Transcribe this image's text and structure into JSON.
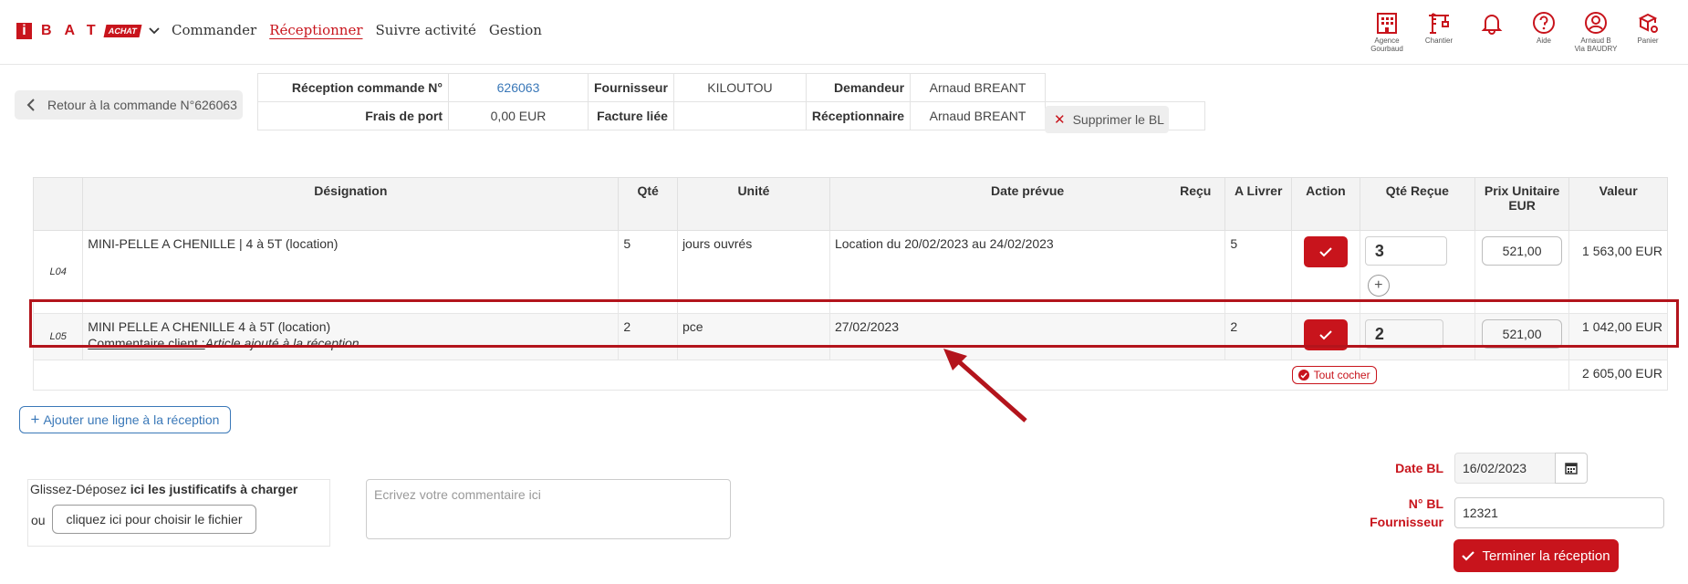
{
  "header": {
    "logo_i": "i",
    "logo_letters": "BAT",
    "logo_tag": "ACHAT",
    "nav": [
      "Commander",
      "Réceptionner",
      "Suivre activité",
      "Gestion"
    ],
    "icons": [
      {
        "name": "agency-icon",
        "label": "Agence\nGourbaud"
      },
      {
        "name": "crane-icon",
        "label": "Chantier"
      },
      {
        "name": "bell-icon",
        "label": ""
      },
      {
        "name": "help-icon",
        "label": "Aide"
      },
      {
        "name": "user-icon",
        "label": "Arnaud B\nVia BAUDRY"
      },
      {
        "name": "cart-icon",
        "label": "Panier"
      }
    ]
  },
  "info": {
    "back_label": "Retour à la commande N°626063",
    "reception_label": "Réception commande N°",
    "reception_value": "626063",
    "supplier_label": "Fournisseur",
    "supplier_value": "KILOUTOU",
    "requester_label": "Demandeur",
    "requester_value": "Arnaud BREANT",
    "shipping_label": "Frais de port",
    "shipping_value": "0,00 EUR",
    "invoice_label": "Facture liée",
    "invoice_value": "",
    "receiver_label": "Réceptionnaire",
    "receiver_value": "Arnaud BREANT",
    "delete_bl_label": "Supprimer le BL"
  },
  "table": {
    "headers": {
      "designation": "Désignation",
      "qty": "Qté",
      "unit": "Unité",
      "date": "Date prévue",
      "recu": "Reçu",
      "a_livrer": "A Livrer",
      "action": "Action",
      "qty_recue": "Qté Reçue",
      "prix": "Prix Unitaire EUR",
      "valeur": "Valeur"
    },
    "rows": [
      {
        "code": "L04",
        "designation": "MINI-PELLE A CHENILLE | 4 à 5T (location)",
        "qty": "5",
        "unit": "jours ouvrés",
        "date": "Location du 20/02/2023 au 24/02/2023",
        "recu": "",
        "a_livrer": "5",
        "qty_recue": "3",
        "prix": "521,00",
        "valeur": "1 563,00 EUR"
      },
      {
        "code": "L05",
        "designation": "MINI PELLE A CHENILLE 4 à 5T (location)",
        "comment_label": "Commentaire client :",
        "comment_text": "Article ajouté à la réception.",
        "qty": "2",
        "unit": "pce",
        "date": "27/02/2023",
        "recu": "",
        "a_livrer": "2",
        "qty_recue": "2",
        "prix": "521,00",
        "valeur": "1 042,00 EUR"
      }
    ],
    "tout_cocher": "Tout cocher",
    "total": "2 605,00 EUR"
  },
  "bottom": {
    "add_line_label": "Ajouter une ligne à la réception",
    "drop_text_prefix": "Glissez-Déposez ",
    "drop_text_bold": "ici les justificatifs à charger",
    "ou": "ou",
    "choose_file_label": "cliquez ici pour choisir le fichier",
    "comment_placeholder": "Ecrivez votre commentaire ici",
    "date_bl_label": "Date BL",
    "date_bl_value": "16/02/2023",
    "bl_number_label": "N° BL Fournisseur",
    "bl_number_value": "12321",
    "finish_label": "Terminer la réception"
  },
  "colors": {
    "brand": "#c8141c",
    "link": "#3a78b8"
  }
}
